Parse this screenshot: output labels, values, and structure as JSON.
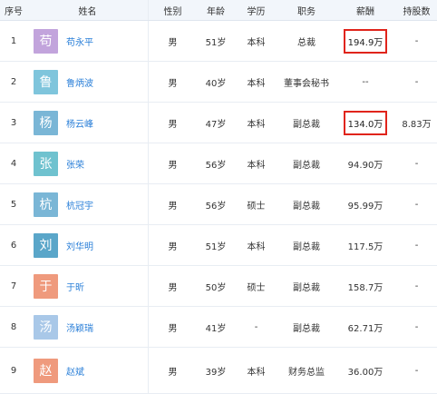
{
  "headers": [
    "序号",
    "姓名",
    "性别",
    "年龄",
    "学历",
    "职务",
    "薪酬",
    "持股数"
  ],
  "highlight_color": "#e0241b",
  "rows": [
    {
      "idx": "1",
      "avatar": "苟",
      "avatar_color": "#c2a4dc",
      "name": "苟永平",
      "gender": "男",
      "age": "51岁",
      "edu": "本科",
      "pos": "总裁",
      "salary": "194.9万",
      "salary_highlighted": true,
      "shares": "-"
    },
    {
      "idx": "2",
      "avatar": "鲁",
      "avatar_color": "#7fc5dc",
      "name": "鲁炳波",
      "gender": "男",
      "age": "40岁",
      "edu": "本科",
      "pos": "董事会秘书",
      "salary": "--",
      "salary_highlighted": false,
      "shares": "-"
    },
    {
      "idx": "3",
      "avatar": "杨",
      "avatar_color": "#7ab6d6",
      "name": "杨云峰",
      "gender": "男",
      "age": "47岁",
      "edu": "本科",
      "pos": "副总裁",
      "salary": "134.0万",
      "salary_highlighted": true,
      "shares": "8.83万"
    },
    {
      "idx": "4",
      "avatar": "张",
      "avatar_color": "#6fc2cf",
      "name": "张荣",
      "gender": "男",
      "age": "56岁",
      "edu": "本科",
      "pos": "副总裁",
      "salary": "94.90万",
      "salary_highlighted": false,
      "shares": "-"
    },
    {
      "idx": "5",
      "avatar": "杭",
      "avatar_color": "#7ab6d6",
      "name": "杭冠宇",
      "gender": "男",
      "age": "56岁",
      "edu": "硕士",
      "pos": "副总裁",
      "salary": "95.99万",
      "salary_highlighted": false,
      "shares": "-"
    },
    {
      "idx": "6",
      "avatar": "刘",
      "avatar_color": "#5aa6c9",
      "name": "刘华明",
      "gender": "男",
      "age": "51岁",
      "edu": "本科",
      "pos": "副总裁",
      "salary": "117.5万",
      "salary_highlighted": false,
      "shares": "-"
    },
    {
      "idx": "7",
      "avatar": "于",
      "avatar_color": "#ef9a7d",
      "name": "于昕",
      "gender": "男",
      "age": "50岁",
      "edu": "硕士",
      "pos": "副总裁",
      "salary": "158.7万",
      "salary_highlighted": false,
      "shares": "-"
    },
    {
      "idx": "8",
      "avatar": "汤",
      "avatar_color": "#a9c8e8",
      "name": "汤颖瑞",
      "gender": "男",
      "age": "41岁",
      "edu": "-",
      "pos": "副总裁",
      "salary": "62.71万",
      "salary_highlighted": false,
      "shares": "-"
    },
    {
      "idx": "9",
      "avatar": "赵",
      "avatar_color": "#ef9a7d",
      "name": "赵斌",
      "gender": "男",
      "age": "39岁",
      "edu": "本科",
      "pos": "财务总监",
      "salary": "36.00万",
      "salary_highlighted": false,
      "shares": "-"
    }
  ]
}
